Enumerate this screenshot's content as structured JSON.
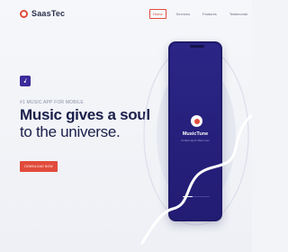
{
  "brand": {
    "name": "SaasTec"
  },
  "nav": {
    "items": [
      {
        "label": "Home",
        "active": true
      },
      {
        "label": "Services",
        "active": false
      },
      {
        "label": "Features",
        "active": false
      },
      {
        "label": "Testimonial",
        "active": false
      }
    ]
  },
  "hero": {
    "subtitle": "#1 MUSIC APP FOR MOBILE",
    "headline_line1": "Music gives a soul",
    "headline_line2": "to the universe.",
    "cta_label": "DOWNLOAD NOW"
  },
  "phone": {
    "app_name": "MusicTune",
    "tagline": "#1 Music app for Music Lover",
    "progress": 0.35
  },
  "colors": {
    "accent": "#e14b3b",
    "phone_bg": "#221c73",
    "heading": "#1b1f4a"
  },
  "icons": [
    "music-note-icon",
    "play-logo-icon"
  ]
}
